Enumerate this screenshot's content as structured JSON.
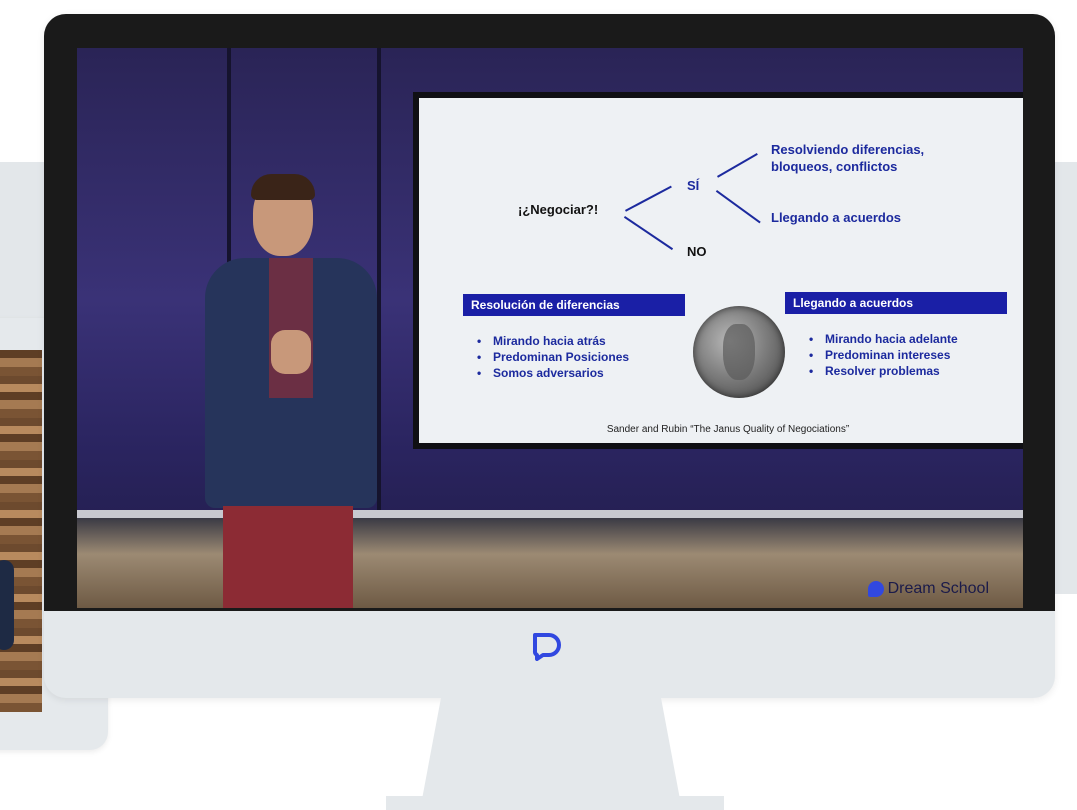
{
  "slide": {
    "question": "¡¿Negociar?!",
    "yes": "SÍ",
    "no": "NO",
    "branch_top_line1": "Resolviendo diferencias,",
    "branch_top_line2": "bloqueos, conflictos",
    "branch_bottom": "Llegando a acuerdos",
    "left_box": "Resolución de diferencias",
    "right_box": "Llegando a acuerdos",
    "left_bullets": [
      "Mirando hacia atrás",
      "Predominan Posiciones",
      "Somos adversarios"
    ],
    "right_bullets": [
      "Mirando hacia adelante",
      "Predominan intereses",
      "Resolver problemas"
    ],
    "citation": "Sander and Rubin “The Janus Quality of Negociations”"
  },
  "watermark": {
    "text": "Dream School",
    "icon": "dream-school-logo-icon"
  },
  "monitor": {
    "chin_icon": "dream-school-logo-icon"
  },
  "colors": {
    "accent_blue": "#1a1fa6",
    "text_blue": "#1c2a9e",
    "logo_blue": "#3148e0",
    "device_gray": "#e4e8eb"
  }
}
